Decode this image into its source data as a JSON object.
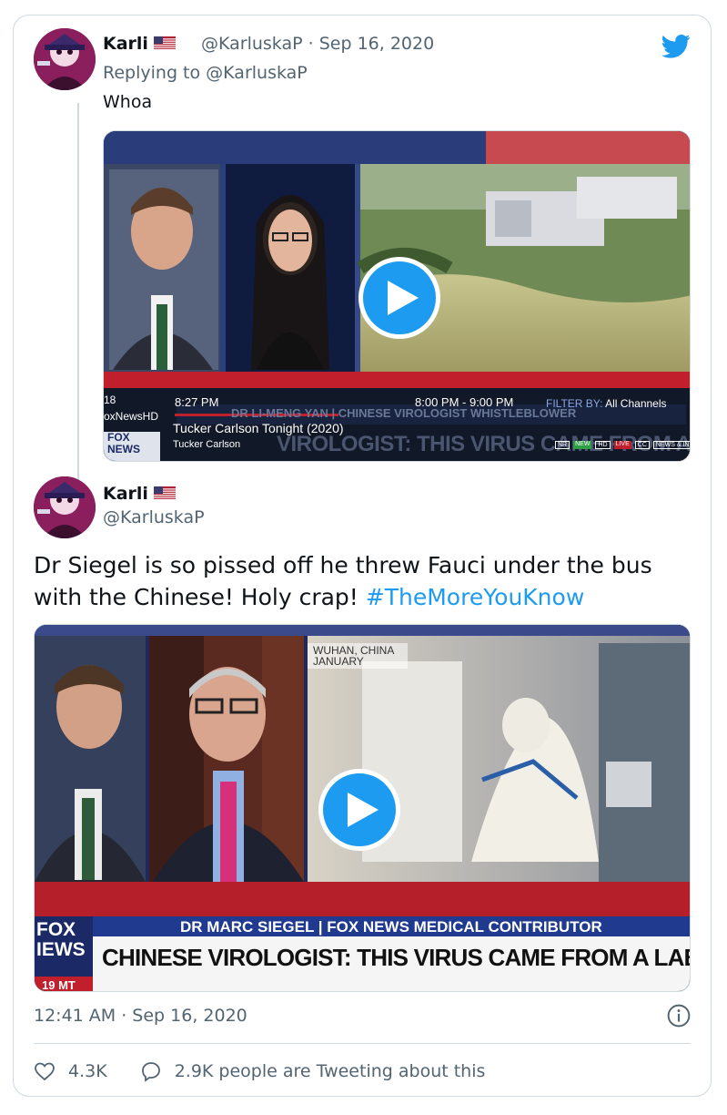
{
  "reply_tweet": {
    "author_name": "Karli",
    "handle": "@KarluskaP",
    "separator": "·",
    "date": "Sep 16, 2020",
    "replying_prefix": "Replying to",
    "replying_handle": "@KarluskaP",
    "text": "Whoa",
    "video": {
      "time_left": "8:27 PM",
      "channel_left": "18",
      "channel_name": "oxNewsHD",
      "time_range": "8:00 PM - 9:00 PM",
      "filter_label": "FILTER BY:",
      "filter_value": "All Channels",
      "program": "Tucker Carlson Tonight (2020)",
      "host": "Tucker Carlson",
      "ticker_back": "VIROLOGIST: THIS VIRUS CAME FROM A LAB",
      "ticker_top": "DR LI-MENG YAN | CHINESE VIROLOGIST WHISTLEBLOWER",
      "logo_top": "FOX",
      "logo_bottom": "NEWS",
      "badges": [
        "NR",
        "NEW",
        "HD",
        "LIVE",
        "CC",
        "NEWS & INFO"
      ]
    }
  },
  "main_tweet": {
    "author_name": "Karli",
    "handle": "@KarluskaP",
    "text": "Dr Siegel is so pissed off he threw Fauci under the bus with the Chinese! Holy crap! ",
    "hashtag": "#TheMoreYouKnow",
    "video": {
      "location_line1": "WUHAN, CHINA",
      "location_line2": "JANUARY",
      "lower_third_name": "DR MARC SIEGEL | FOX NEWS MEDICAL CONTRIBUTOR",
      "headline": "CHINESE VIROLOGIST: THIS VIRUS CAME FROM A LAB",
      "logo_top": "FOX",
      "logo_bottom": "IEWS",
      "clock": "19 MT"
    },
    "timestamp": "12:41 AM · Sep 16, 2020",
    "likes": "4.3K",
    "tweeting_about": "2.9K people are Tweeting about this"
  },
  "colors": {
    "twitter_blue": "#1d9bf0",
    "secondary_text": "#536471",
    "border": "#cfd9de"
  }
}
